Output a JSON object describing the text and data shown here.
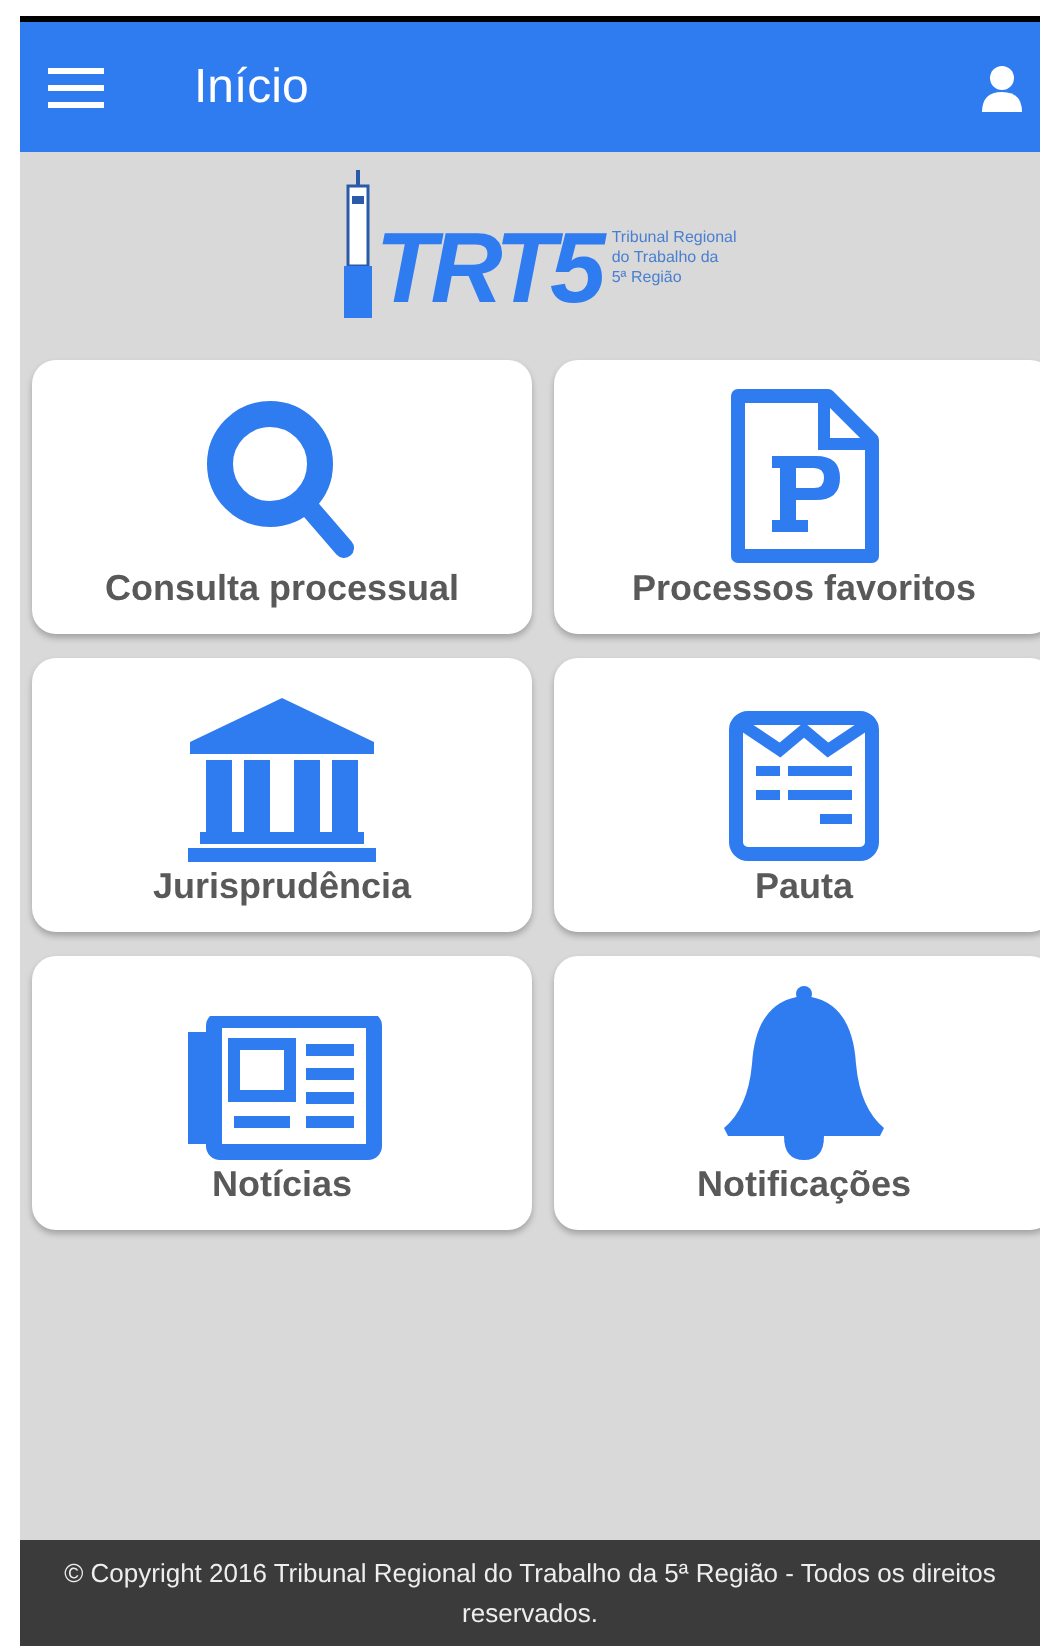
{
  "header": {
    "title": "Início"
  },
  "logo": {
    "mark": "TRT5",
    "lines": [
      "Tribunal Regional",
      "do Trabalho da",
      "5ª Região"
    ]
  },
  "tiles": [
    {
      "kind": "search",
      "label": "Consulta processual"
    },
    {
      "kind": "document",
      "label": "Processos favoritos"
    },
    {
      "kind": "court",
      "label": "Jurisprudência"
    },
    {
      "kind": "agenda",
      "label": "Pauta"
    },
    {
      "kind": "news",
      "label": "Notícias"
    },
    {
      "kind": "bell",
      "label": "Notificações"
    }
  ],
  "footer": {
    "text": "© Copyright 2016 Tribunal Regional do Trabalho da 5ª Região - Todos os direitos reservados."
  }
}
